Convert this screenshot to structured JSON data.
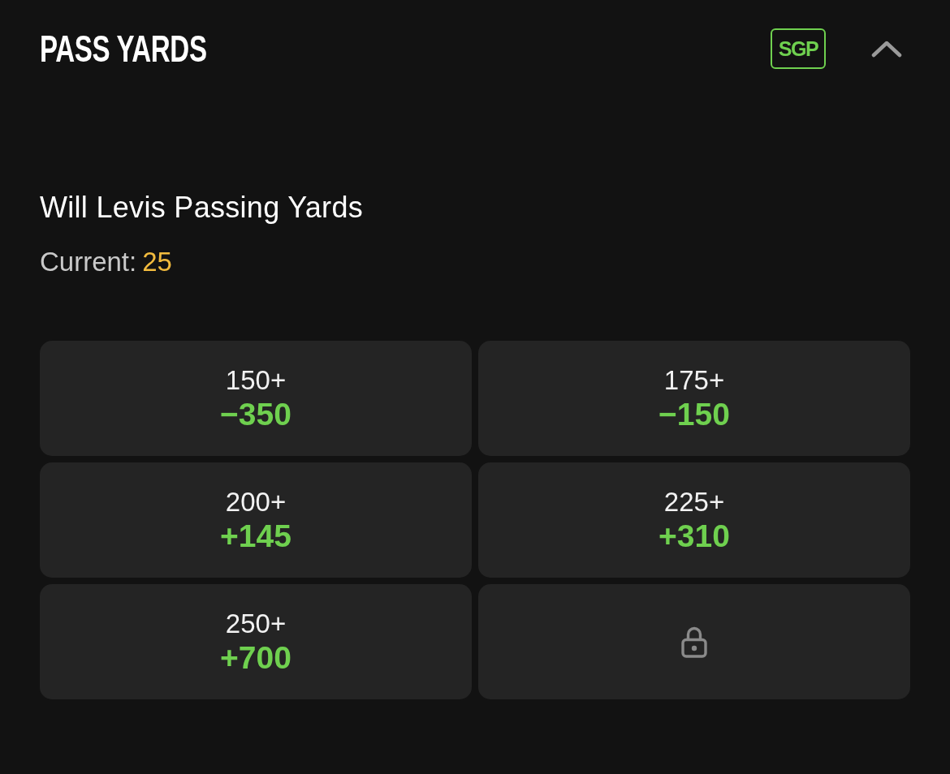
{
  "header": {
    "title": "PASS YARDS",
    "badge": "SGP",
    "expanded": true
  },
  "market": {
    "title": "Will Levis Passing Yards",
    "current_label": "Current:",
    "current_value": "25"
  },
  "options": [
    {
      "kind": "odds",
      "label": "150+",
      "odds": "−350"
    },
    {
      "kind": "odds",
      "label": "175+",
      "odds": "−150"
    },
    {
      "kind": "odds",
      "label": "200+",
      "odds": "+145"
    },
    {
      "kind": "odds",
      "label": "225+",
      "odds": "+310"
    },
    {
      "kind": "odds",
      "label": "250+",
      "odds": "+700"
    },
    {
      "kind": "locked"
    }
  ]
}
